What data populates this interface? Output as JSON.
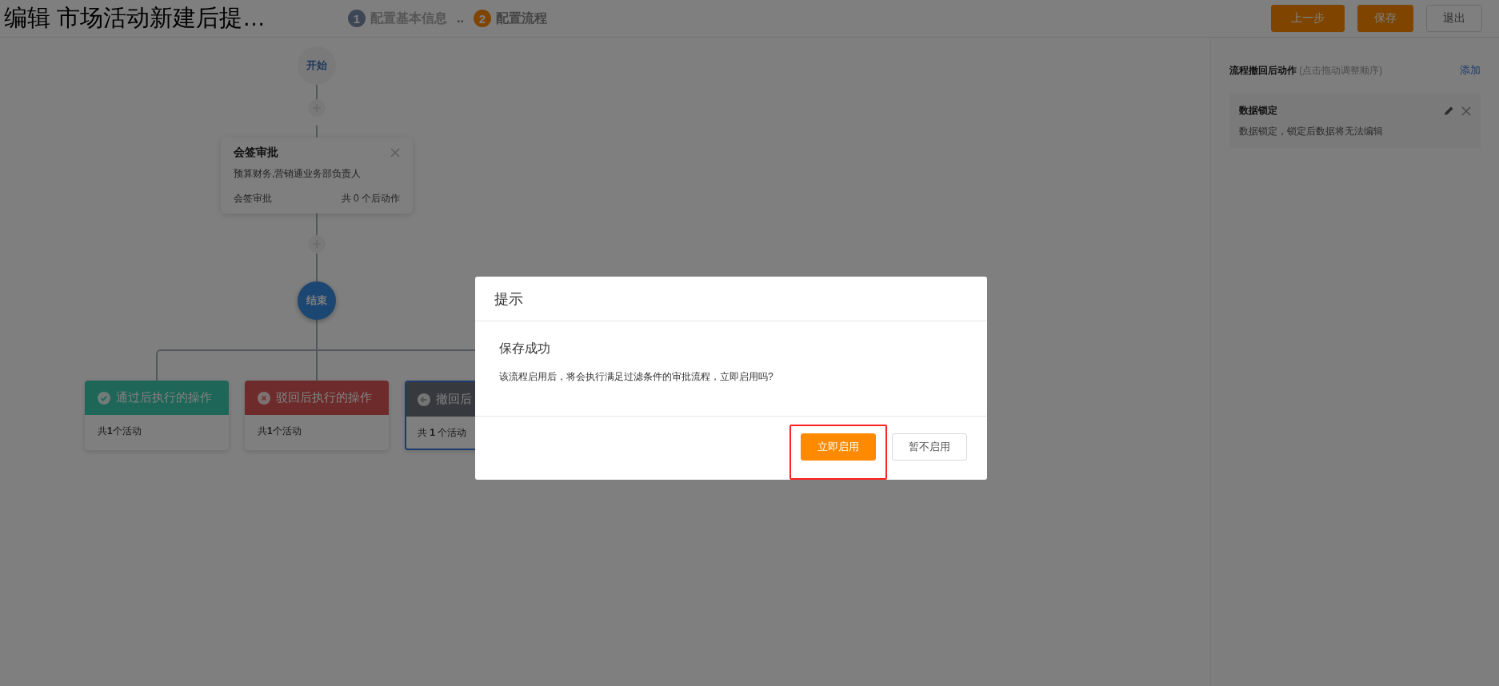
{
  "header": {
    "title": "编辑 市场活动新建后提…",
    "steps": [
      {
        "number": "1",
        "label": "配置基本信息",
        "selected": false
      },
      {
        "number": "2",
        "label": "配置流程",
        "selected": true
      }
    ],
    "step_separator": "..",
    "buttons": [
      {
        "label": "上一步",
        "kind": "primary"
      },
      {
        "label": "保存",
        "kind": "primary"
      },
      {
        "label": "退出",
        "kind": "default"
      }
    ]
  },
  "flow": {
    "start": "开始",
    "end": "结束",
    "node": {
      "title": "会签审批",
      "approvers": "预算财务,营销通业务部负责人",
      "type": "会签审批",
      "actions": "共 0 个后动作"
    },
    "branches": [
      {
        "kind": "pass",
        "title": "通过后执行的操作",
        "summary": "共**1**个活动",
        "selected": false
      },
      {
        "kind": "reject",
        "title": "驳回后执行的操作",
        "summary": "共**1**个活动",
        "selected": false
      },
      {
        "kind": "withdraw",
        "title": "撤回后",
        "summary": "共 **1** 个活动",
        "selected": true
      }
    ]
  },
  "side_panel": {
    "title": "流程撤回后动作",
    "hint": "(点击拖动调整顺序)",
    "add": "添加",
    "actions": [
      {
        "title": "数据锁定",
        "description": "数据锁定，锁定后数据将无法编辑"
      }
    ]
  },
  "dialog": {
    "title": "提示",
    "heading": "保存成功",
    "message": "该流程启用后，将会执行满足过滤条件的审批流程，立即启用吗?",
    "buttons": [
      {
        "label": "立即启用",
        "kind": "primary",
        "highlighted": true
      },
      {
        "label": "暂不启用",
        "kind": "default",
        "highlighted": false
      }
    ]
  }
}
